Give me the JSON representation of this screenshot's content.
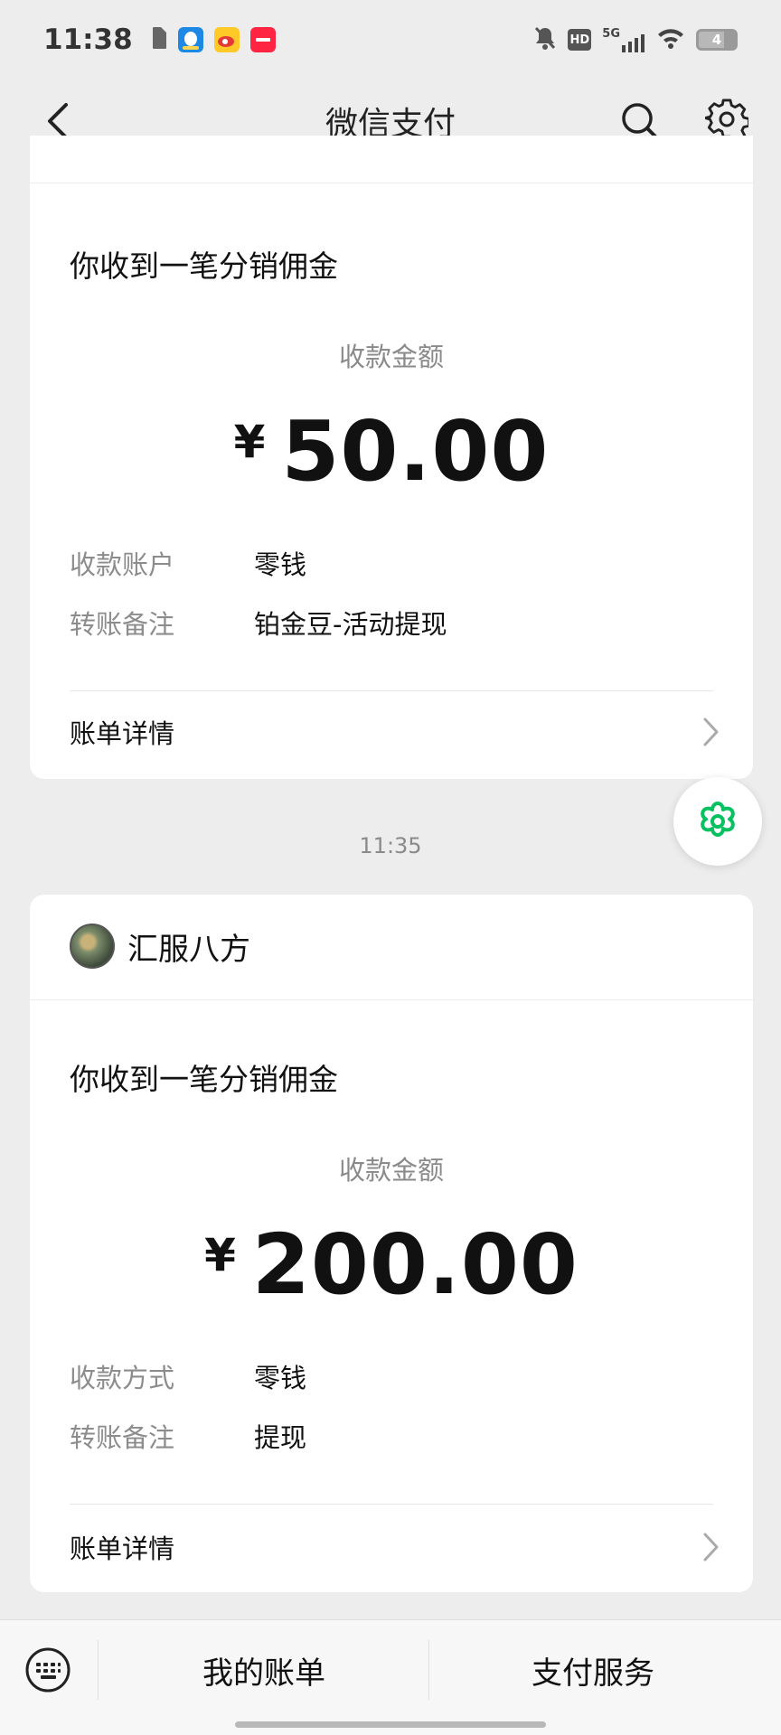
{
  "status_bar": {
    "time": "11:38",
    "battery_level": "4",
    "network": "5G",
    "hd_badge": "HD",
    "icons": [
      "sim-icon",
      "qq-app-icon",
      "weibo-app-icon",
      "xiaohongshu-app-icon",
      "mute-bell-icon",
      "hd-icon",
      "signal-5g-icon",
      "wifi-icon",
      "battery-icon"
    ]
  },
  "header": {
    "title": "微信支付",
    "icons": [
      "back-icon",
      "search-icon",
      "gear-icon"
    ]
  },
  "messages": [
    {
      "headline": "你收到一笔分销佣金",
      "amount_label": "收款金额",
      "currency": "¥",
      "amount": "50.00",
      "rows": [
        {
          "key": "收款账户",
          "value": "零钱"
        },
        {
          "key": "转账备注",
          "value": "铂金豆-活动提现"
        }
      ],
      "detail_label": "账单详情"
    },
    {
      "time": "11:35",
      "sender": "汇服八方",
      "headline": "你收到一笔分销佣金",
      "amount_label": "收款金额",
      "currency": "¥",
      "amount": "200.00",
      "rows": [
        {
          "key": "收款方式",
          "value": "零钱"
        },
        {
          "key": "转账备注",
          "value": "提现"
        }
      ],
      "detail_label": "账单详情"
    }
  ],
  "bottom_bar": {
    "items": [
      "我的账单",
      "支付服务"
    ]
  },
  "colors": {
    "background": "#ededed",
    "card": "#ffffff",
    "accent_green": "#07c160",
    "muted_text": "#8a8a8a"
  }
}
